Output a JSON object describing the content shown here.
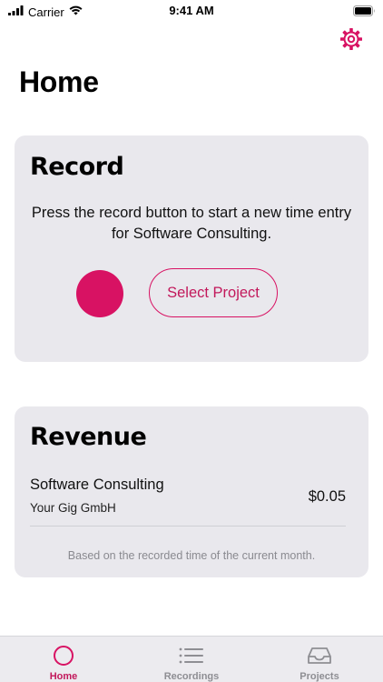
{
  "status_bar": {
    "carrier": "Carrier",
    "time": "9:41 AM",
    "icons": [
      "signal-bars-icon",
      "wifi-icon",
      "battery-icon"
    ]
  },
  "header": {
    "title": "Home",
    "settings_icon": "gear-icon"
  },
  "record_card": {
    "title": "Record",
    "description": "Press the record button to start a new time entry for Software Consulting.",
    "record_icon": "record-dot-icon",
    "select_project_label": "Select Project"
  },
  "revenue_card": {
    "title": "Revenue",
    "project": "Software Consulting",
    "client": "Your Gig GmbH",
    "amount": "$0.05",
    "note": "Based on the recorded time of the current month."
  },
  "tab_bar": {
    "items": [
      {
        "label": "Home",
        "icon": "circle-icon",
        "active": true
      },
      {
        "label": "Recordings",
        "icon": "list-icon",
        "active": false
      },
      {
        "label": "Projects",
        "icon": "inbox-tray-icon",
        "active": false
      }
    ]
  },
  "colors": {
    "accent": "#d81263",
    "card_background": "#e9e8ed",
    "tab_inactive": "#8e8e93"
  }
}
